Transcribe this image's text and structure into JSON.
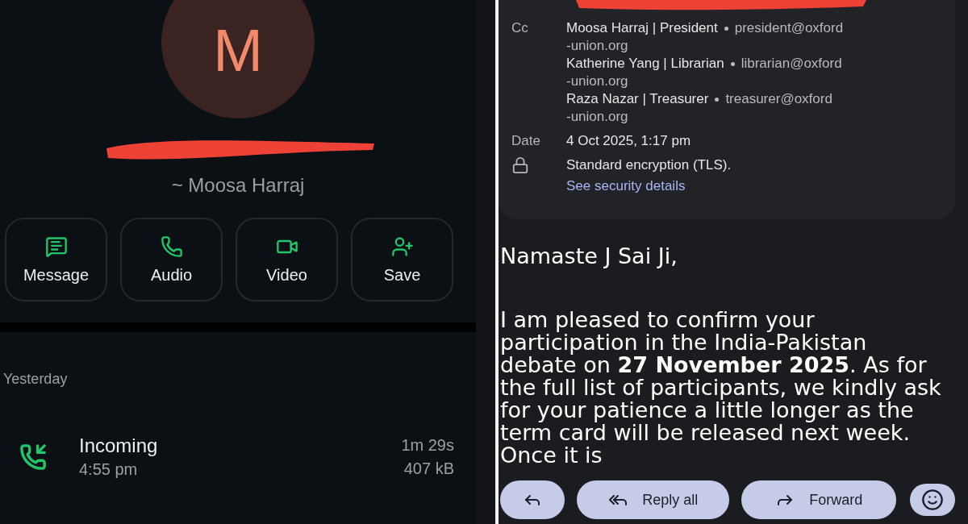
{
  "contact": {
    "avatar_letter": "M",
    "name": "~ Moosa Harraj"
  },
  "actions": [
    {
      "kind": "message",
      "label": "Message"
    },
    {
      "kind": "audio",
      "label": "Audio"
    },
    {
      "kind": "video",
      "label": "Video"
    },
    {
      "kind": "save",
      "label": "Save"
    }
  ],
  "call_log": {
    "heading": "Yesterday",
    "calls": [
      {
        "kind": "incoming",
        "type": "Incoming",
        "time": "4:55 pm",
        "duration": "1m 29s",
        "size": "407 kB"
      }
    ]
  },
  "email": {
    "cc": {
      "label": "Cc",
      "recipients": [
        {
          "name": "Moosa Harraj | President",
          "address": "president@oxford",
          "address_cont": "-union.org"
        },
        {
          "name": "Katherine Yang | Librarian",
          "address": "librarian@oxford",
          "address_cont": "-union.org"
        },
        {
          "name": "Raza Nazar | Treasurer",
          "address": "treasurer@oxford",
          "address_cont": "-union.org"
        }
      ]
    },
    "date": {
      "label": "Date",
      "value": "4 Oct 2025, 1:17 pm"
    },
    "security": {
      "text": "Standard encryption (TLS).",
      "link": "See security details"
    },
    "greeting": "Namaste J Sai Ji,",
    "body": "I am pleased to confirm your participation in the India-Pakistan debate on **27 November 2025**. As for the full list of participants, we kindly ask for your patience a little longer as the term card will be released next week. Once it is",
    "actions": [
      {
        "kind": "reply"
      },
      {
        "kind": "reply_all",
        "label": "Reply all"
      },
      {
        "kind": "forward",
        "label": "Forward"
      },
      {
        "kind": "emoji"
      }
    ]
  }
}
